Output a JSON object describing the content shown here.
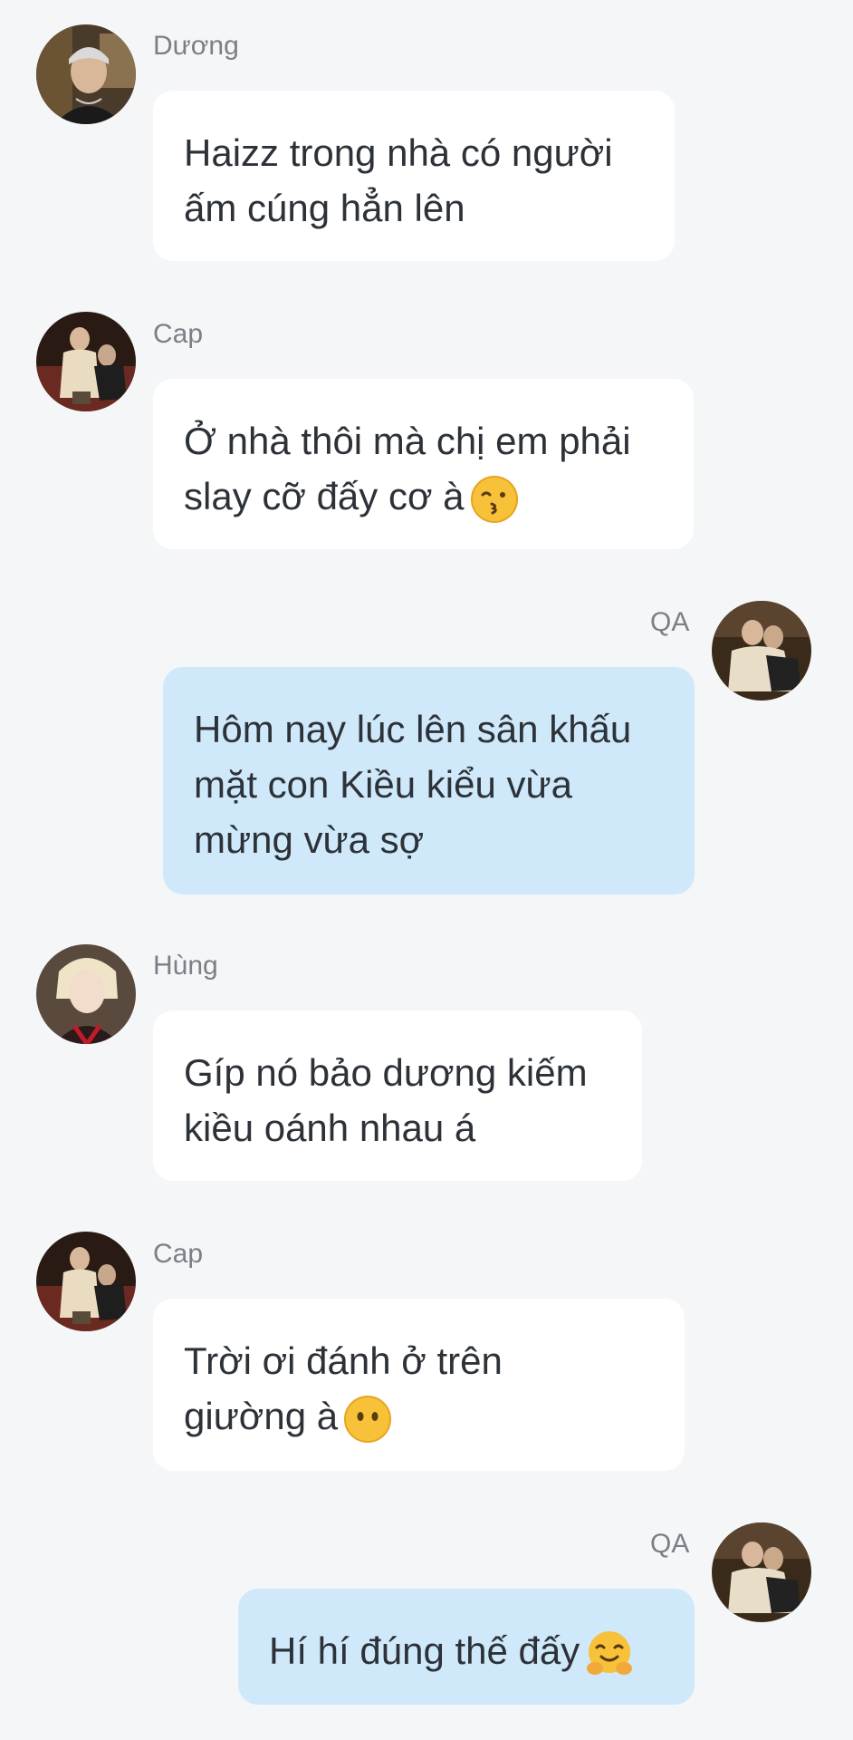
{
  "messages": [
    {
      "sender": "Dương",
      "direction": "incoming",
      "avatar": "avatar-duong",
      "lines": [
        "Haizz trong nhà có người",
        "ấm cúng hẳn lên"
      ],
      "emoji": null
    },
    {
      "sender": "Cap",
      "direction": "incoming",
      "avatar": "avatar-cap",
      "lines": [
        "Ở nhà thôi mà chị em phải",
        "slay cỡ đấy cơ à"
      ],
      "emoji": "kissing-face-emoji"
    },
    {
      "sender": "QA",
      "direction": "outgoing",
      "avatar": "avatar-qa",
      "lines": [
        "Hôm nay lúc lên sân khấu",
        "mặt con Kiều kiểu vừa",
        "mừng vừa sợ"
      ],
      "emoji": null
    },
    {
      "sender": "Hùng",
      "direction": "incoming",
      "avatar": "avatar-hung",
      "lines": [
        "Gíp nó bảo dương kiếm",
        "kiều oánh nhau á"
      ],
      "emoji": null
    },
    {
      "sender": "Cap",
      "direction": "incoming",
      "avatar": "avatar-cap",
      "lines": [
        "Trời ơi đánh ở trên",
        "giường à"
      ],
      "emoji": "face-without-mouth-emoji"
    },
    {
      "sender": "QA",
      "direction": "outgoing",
      "avatar": "avatar-qa",
      "lines": [
        "Hí hí đúng thế đấy"
      ],
      "emoji": "hugging-face-emoji"
    }
  ],
  "colors": {
    "background": "#f5f6f8",
    "incoming_bubble": "#ffffff",
    "outgoing_bubble": "#cfe9fb",
    "text": "#2d3238",
    "sender_name": "#7b7f86"
  }
}
